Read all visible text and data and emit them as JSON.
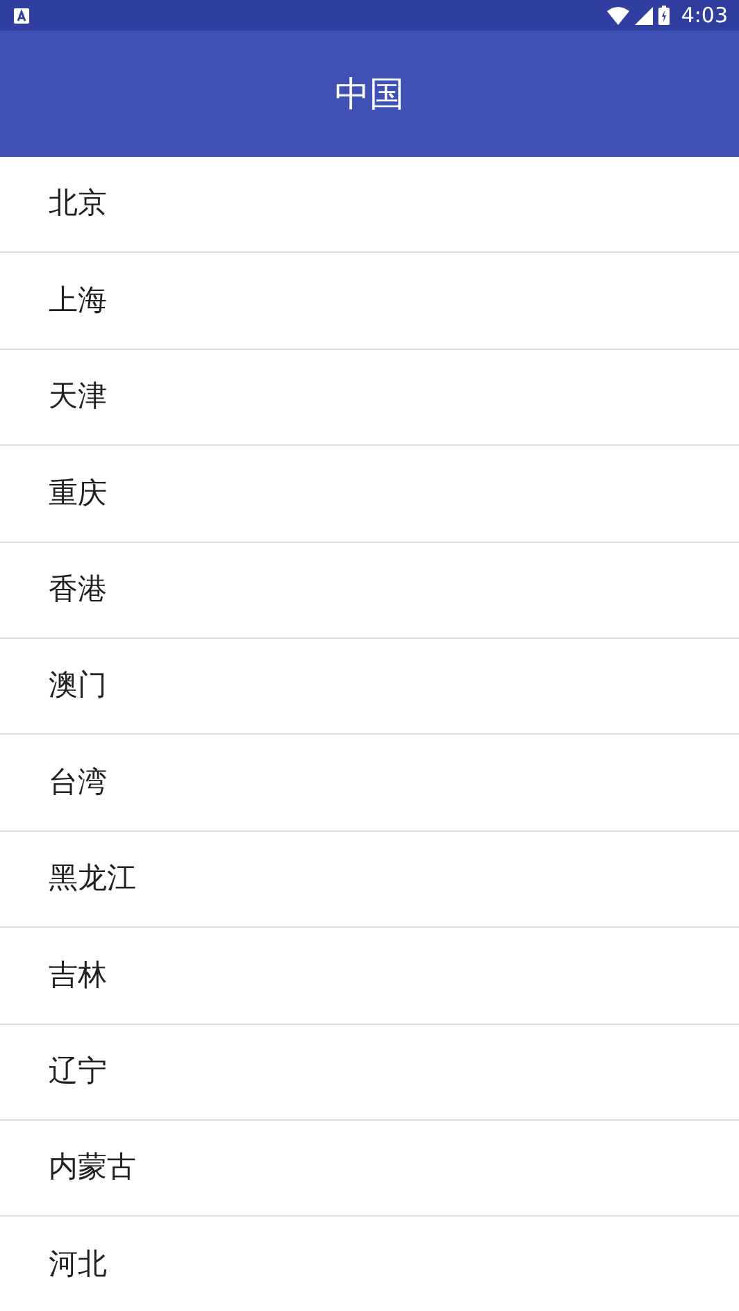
{
  "status_bar": {
    "time": "4:03"
  },
  "app_bar": {
    "title": "中国"
  },
  "provinces": [
    {
      "label": "北京"
    },
    {
      "label": "上海"
    },
    {
      "label": "天津"
    },
    {
      "label": "重庆"
    },
    {
      "label": "香港"
    },
    {
      "label": "澳门"
    },
    {
      "label": "台湾"
    },
    {
      "label": "黑龙江"
    },
    {
      "label": "吉林"
    },
    {
      "label": "辽宁"
    },
    {
      "label": "内蒙古"
    },
    {
      "label": "河北"
    }
  ]
}
